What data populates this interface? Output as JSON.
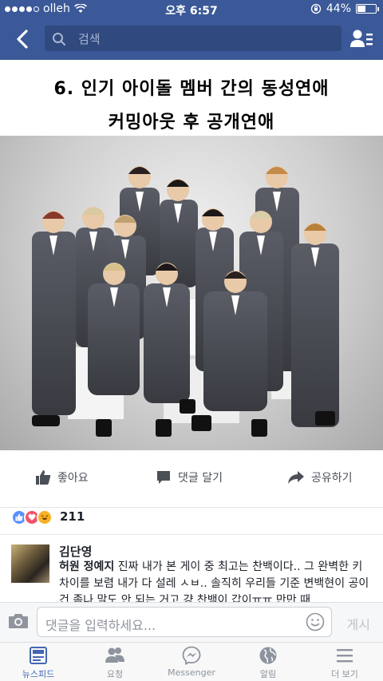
{
  "status": {
    "carrier": "olleh",
    "time": "오후 6:57",
    "battery": "44%",
    "battery_level": 0.44
  },
  "nav": {
    "search_placeholder": "검색"
  },
  "post": {
    "caption_line1": "6. 인기 아이돌 멤버 간의 동성연애",
    "caption_line2": "커밍아웃 후 공개연애"
  },
  "actions": {
    "like": "좋아요",
    "comment": "댓글 달기",
    "share": "공유하기"
  },
  "reactions": {
    "count": "211"
  },
  "comment": {
    "author": "김단영",
    "tagged": "허원 정예지",
    "text": " 진짜 내가 본 게이 중 최고는 찬백이다.. 그 완벽한 키 차이를 보렴 내가 다 설레 ㅅㅂ.. 솔직히 우리들 기준 변백현이 공이건 좀나 말도 안 되는 거고 걍 찬백이 갑이ㅠㅠ 만만 때"
  },
  "composer": {
    "placeholder": "댓글을 입력하세요...",
    "post_label": "게시"
  },
  "tabs": [
    {
      "label": "뉴스피드",
      "icon": "newsfeed-icon"
    },
    {
      "label": "요청",
      "icon": "friend-requests-icon"
    },
    {
      "label": "Messenger",
      "icon": "messenger-icon"
    },
    {
      "label": "알림",
      "icon": "globe-icon"
    },
    {
      "label": "더 보기",
      "icon": "menu-icon"
    }
  ]
}
